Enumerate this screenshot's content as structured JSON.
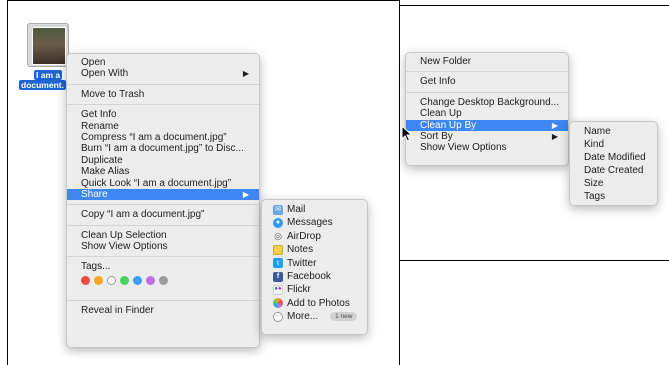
{
  "desktop_file": {
    "label_line1": "I am a",
    "label_line2": "document."
  },
  "context_menu": {
    "items": [
      {
        "label": "Open"
      },
      {
        "label": "Open With",
        "submenu": true
      },
      {
        "label": "Move to Trash"
      },
      {
        "label": "Get Info"
      },
      {
        "label": "Rename"
      },
      {
        "label": "Compress “I am a document.jpg”"
      },
      {
        "label": "Burn “I am a document.jpg” to Disc..."
      },
      {
        "label": "Duplicate"
      },
      {
        "label": "Make Alias"
      },
      {
        "label": "Quick Look “I am a document.jpg”"
      },
      {
        "label": "Share",
        "submenu": true,
        "highlighted": true
      },
      {
        "label": "Copy “I am a document.jpg”"
      },
      {
        "label": "Clean Up Selection"
      },
      {
        "label": "Show View Options"
      },
      {
        "label": "Tags..."
      },
      {
        "label": "Reveal in Finder"
      }
    ],
    "tag_colors": [
      "#ee4b3f",
      "#f5a623",
      "#ffffff",
      "#4cd15a",
      "#3a9ef5",
      "#c36ee0",
      "#9b9b9b"
    ]
  },
  "share_menu": {
    "items": [
      {
        "label": "Mail",
        "icon": "mail-icon",
        "color": "#6aa7e8"
      },
      {
        "label": "Messages",
        "icon": "messages-icon",
        "color": "#2f9cf0"
      },
      {
        "label": "AirDrop",
        "icon": "airdrop-icon",
        "color": "#7a7a7a"
      },
      {
        "label": "Notes",
        "icon": "notes-icon",
        "color": "#f4cf4a"
      },
      {
        "label": "Twitter",
        "icon": "twitter-icon",
        "color": "#1da1f2"
      },
      {
        "label": "Facebook",
        "icon": "facebook-icon",
        "color": "#3b5998"
      },
      {
        "label": "Flickr",
        "icon": "flickr-icon",
        "color": "#ffffff"
      },
      {
        "label": "Add to Photos",
        "icon": "photos-icon",
        "color": "#f0a030"
      },
      {
        "label": "More...",
        "icon": "more-icon",
        "color": "#ffffff",
        "badge": "1 new"
      }
    ]
  },
  "desktop_menu": {
    "items": [
      {
        "label": "New Folder"
      },
      {
        "label": "Get Info"
      },
      {
        "label": "Change Desktop Background..."
      },
      {
        "label": "Clean Up"
      },
      {
        "label": "Clean Up By",
        "submenu": true,
        "highlighted": true
      },
      {
        "label": "Sort By",
        "submenu": true
      },
      {
        "label": "Show View Options"
      }
    ]
  },
  "cleanup_menu": {
    "items": [
      {
        "label": "Name"
      },
      {
        "label": "Kind"
      },
      {
        "label": "Date Modified"
      },
      {
        "label": "Date Created"
      },
      {
        "label": "Size"
      },
      {
        "label": "Tags"
      }
    ]
  },
  "arrow_glyph": "▶"
}
